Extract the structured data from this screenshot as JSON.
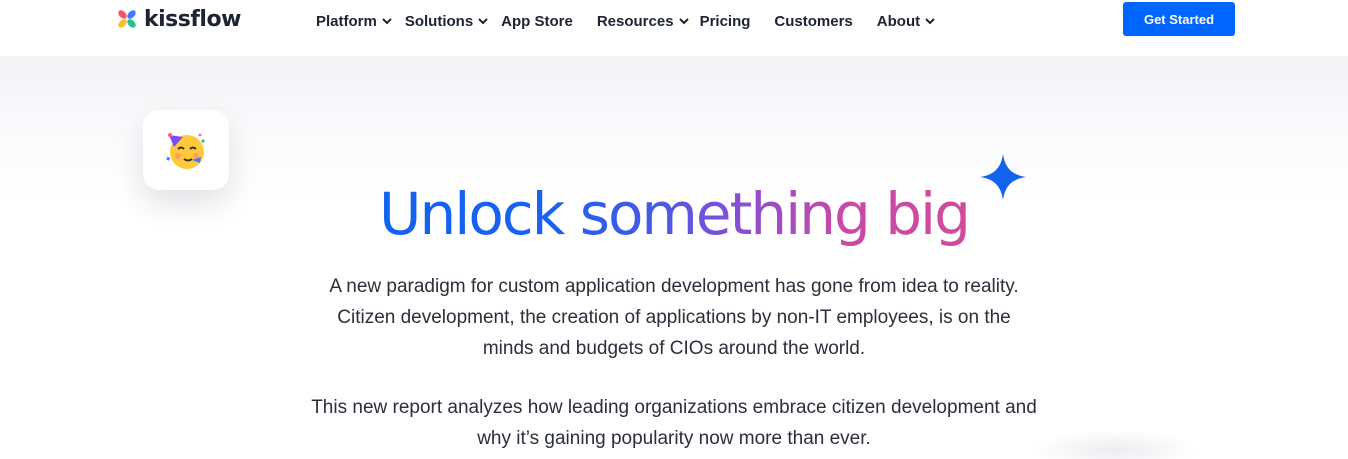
{
  "header": {
    "logo_text": "kissflow",
    "nav": [
      {
        "label": "Platform",
        "has_dropdown": true
      },
      {
        "label": "Solutions",
        "has_dropdown": true
      },
      {
        "label": "App Store",
        "has_dropdown": false
      },
      {
        "label": "Resources",
        "has_dropdown": true
      },
      {
        "label": "Pricing",
        "has_dropdown": false
      },
      {
        "label": "Customers",
        "has_dropdown": false
      },
      {
        "label": "About",
        "has_dropdown": true
      }
    ],
    "cta_label": "Get Started"
  },
  "hero": {
    "emoji_icon": "partying-face-icon",
    "sparkle_icon": "sparkle-icon",
    "headline": "Unlock something big",
    "paragraph_1": "A new paradigm for custom application development has gone from idea to reality.\nCitizen development, the creation of applications by non-IT employees, is on the\nminds and budgets of CIOs around the world.",
    "paragraph_2": "This new report analyzes how leading organizations embrace citizen development and\nwhy it’s gaining popularity now more than ever."
  },
  "colors": {
    "brand_blue": "#0066ff",
    "headline_gradient_start": "#1163ee",
    "headline_gradient_end": "#d14b9c",
    "text_dark": "#1d2333"
  }
}
